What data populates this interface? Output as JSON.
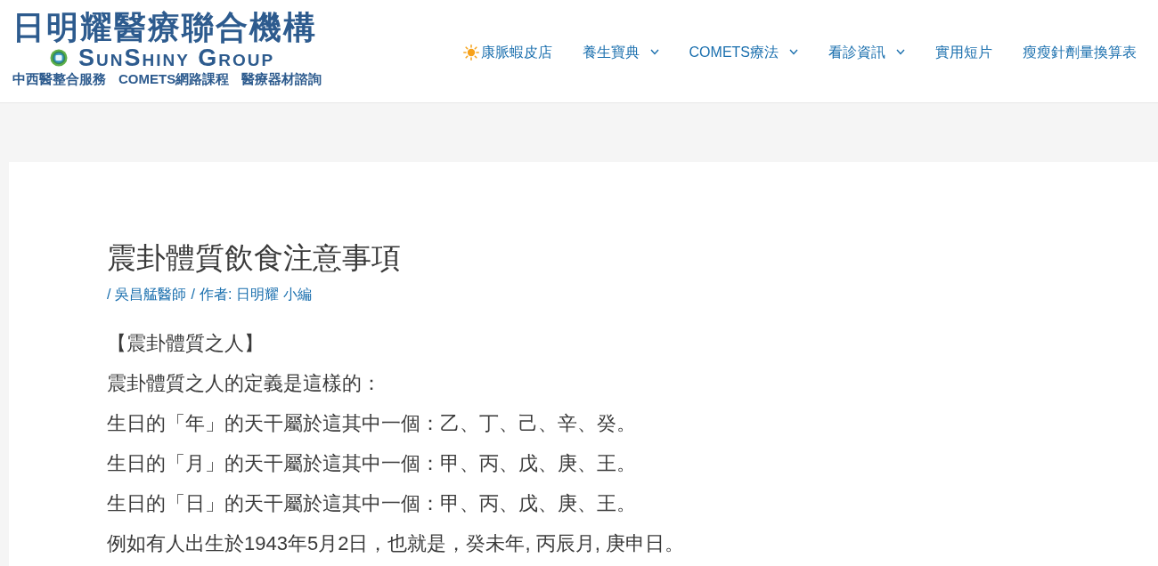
{
  "header": {
    "logo": {
      "title": "日明耀醫療聯合機構",
      "subtitle": "SunShiny Group",
      "tagline": [
        "中西醫整合服務",
        "COMETS網路課程",
        "醫療器材諮詢"
      ]
    },
    "nav": [
      {
        "label": "康脈蝦皮店",
        "kind": "sun"
      },
      {
        "label": "養生寶典",
        "kind": "menu"
      },
      {
        "label": "COMETS療法",
        "kind": "menu"
      },
      {
        "label": "看診資訊",
        "kind": "menu"
      },
      {
        "label": "實用短片",
        "kind": "link"
      },
      {
        "label": "瘦瘦針劑量換算表",
        "kind": "link"
      }
    ]
  },
  "article": {
    "title": "震卦體質飲食注意事項",
    "meta": [
      {
        "separator": "/",
        "link": "吳昌艋醫師"
      },
      {
        "separator": "/",
        "label": "作者:",
        "link": "日明耀 小編"
      }
    ],
    "paragraphs": [
      "【震卦體質之人】",
      "震卦體質之人的定義是這樣的：",
      "生日的「年」的天干屬於這其中一個：乙、丁、己、辛、癸。",
      "生日的「月」的天干屬於這其中一個：甲、丙、戊、庚、王。",
      "生日的「日」的天干屬於這其中一個：甲、丙、戊、庚、王。",
      "例如有人出生於1943年5月2日，也就是，癸未年, 丙辰月, 庚申日。"
    ]
  }
}
